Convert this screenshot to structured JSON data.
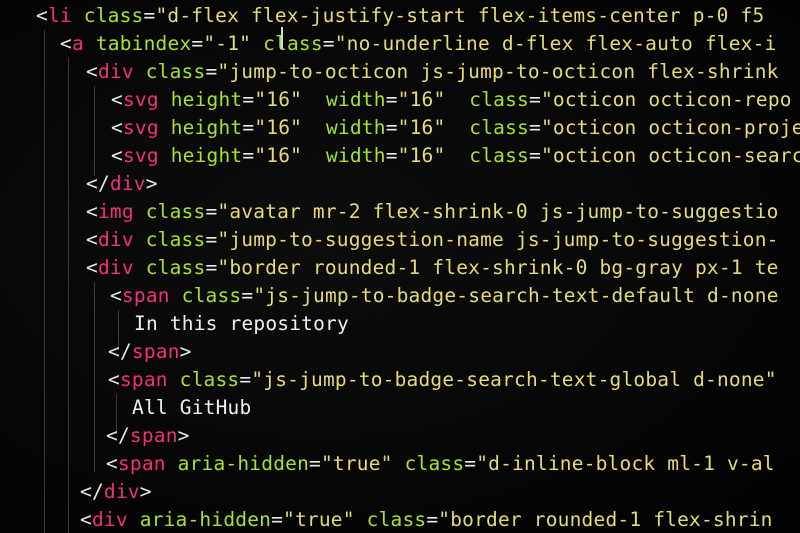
{
  "editor": {
    "lines": [
      {
        "indent": 36,
        "tokens": [
          [
            "punct",
            "<"
          ],
          [
            "tag",
            "li"
          ],
          [
            "text",
            " "
          ],
          [
            "attr",
            "class"
          ],
          [
            "eq",
            "="
          ],
          [
            "str",
            "\"d-flex flex-justify-start flex-items-center p-0 f5"
          ]
        ]
      },
      {
        "indent": 60,
        "tokens": [
          [
            "punct",
            "<"
          ],
          [
            "tag",
            "a"
          ],
          [
            "text",
            " "
          ],
          [
            "attr",
            "tabindex"
          ],
          [
            "eq",
            "="
          ],
          [
            "str",
            "\"-1\""
          ],
          [
            "text",
            " "
          ],
          [
            "attr",
            "class"
          ],
          [
            "eq",
            "="
          ],
          [
            "str",
            "\"no-underline d-flex flex-auto flex-i"
          ]
        ]
      },
      {
        "indent": 86,
        "tokens": [
          [
            "punct",
            "<"
          ],
          [
            "tag",
            "div"
          ],
          [
            "text",
            " "
          ],
          [
            "attr",
            "class"
          ],
          [
            "eq",
            "="
          ],
          [
            "str",
            "\"jump-to-octicon js-jump-to-octicon flex-shrink"
          ]
        ]
      },
      {
        "indent": 111,
        "tokens": [
          [
            "punct",
            "<"
          ],
          [
            "tag",
            "svg"
          ],
          [
            "text",
            " "
          ],
          [
            "attr",
            "height"
          ],
          [
            "eq",
            "="
          ],
          [
            "str",
            "\"16\""
          ],
          [
            "text",
            "  "
          ],
          [
            "attr",
            "width"
          ],
          [
            "eq",
            "="
          ],
          [
            "str",
            "\"16\""
          ],
          [
            "text",
            "  "
          ],
          [
            "attr",
            "class"
          ],
          [
            "eq",
            "="
          ],
          [
            "str",
            "\"octicon octicon-repo"
          ]
        ]
      },
      {
        "indent": 111,
        "tokens": [
          [
            "punct",
            "<"
          ],
          [
            "tag",
            "svg"
          ],
          [
            "text",
            " "
          ],
          [
            "attr",
            "height"
          ],
          [
            "eq",
            "="
          ],
          [
            "str",
            "\"16\""
          ],
          [
            "text",
            "  "
          ],
          [
            "attr",
            "width"
          ],
          [
            "eq",
            "="
          ],
          [
            "str",
            "\"16\""
          ],
          [
            "text",
            "  "
          ],
          [
            "attr",
            "class"
          ],
          [
            "eq",
            "="
          ],
          [
            "str",
            "\"octicon octicon-proje"
          ]
        ]
      },
      {
        "indent": 111,
        "tokens": [
          [
            "punct",
            "<"
          ],
          [
            "tag",
            "svg"
          ],
          [
            "text",
            " "
          ],
          [
            "attr",
            "height"
          ],
          [
            "eq",
            "="
          ],
          [
            "str",
            "\"16\""
          ],
          [
            "text",
            "  "
          ],
          [
            "attr",
            "width"
          ],
          [
            "eq",
            "="
          ],
          [
            "str",
            "\"16\""
          ],
          [
            "text",
            "  "
          ],
          [
            "attr",
            "class"
          ],
          [
            "eq",
            "="
          ],
          [
            "str",
            "\"octicon octicon-searc"
          ]
        ]
      },
      {
        "indent": 86,
        "tokens": [
          [
            "punct",
            "</"
          ],
          [
            "tag",
            "div"
          ],
          [
            "punct",
            ">"
          ]
        ]
      },
      {
        "indent": 86,
        "tokens": [
          [
            "punct",
            "<"
          ],
          [
            "tag",
            "img"
          ],
          [
            "text",
            " "
          ],
          [
            "attr",
            "class"
          ],
          [
            "eq",
            "="
          ],
          [
            "str",
            "\"avatar mr-2 flex-shrink-0 js-jump-to-suggestio"
          ]
        ]
      },
      {
        "indent": 86,
        "tokens": [
          [
            "punct",
            "<"
          ],
          [
            "tag",
            "div"
          ],
          [
            "text",
            " "
          ],
          [
            "attr",
            "class"
          ],
          [
            "eq",
            "="
          ],
          [
            "str",
            "\"jump-to-suggestion-name js-jump-to-suggestion-"
          ]
        ]
      },
      {
        "indent": 86,
        "tokens": [
          [
            "punct",
            "<"
          ],
          [
            "tag",
            "div"
          ],
          [
            "text",
            " "
          ],
          [
            "attr",
            "class"
          ],
          [
            "eq",
            "="
          ],
          [
            "str",
            "\"border rounded-1 flex-shrink-0 bg-gray px-1 te"
          ]
        ]
      },
      {
        "indent": 110,
        "tokens": [
          [
            "punct",
            "<"
          ],
          [
            "tag",
            "span"
          ],
          [
            "text",
            " "
          ],
          [
            "attr",
            "class"
          ],
          [
            "eq",
            "="
          ],
          [
            "str",
            "\"js-jump-to-badge-search-text-default d-none"
          ]
        ]
      },
      {
        "indent": 134,
        "tokens": [
          [
            "text",
            "In this repository"
          ]
        ]
      },
      {
        "indent": 108,
        "tokens": [
          [
            "punct",
            "</"
          ],
          [
            "tag",
            "span"
          ],
          [
            "punct",
            ">"
          ]
        ]
      },
      {
        "indent": 108,
        "tokens": [
          [
            "punct",
            "<"
          ],
          [
            "tag",
            "span"
          ],
          [
            "text",
            " "
          ],
          [
            "attr",
            "class"
          ],
          [
            "eq",
            "="
          ],
          [
            "str",
            "\"js-jump-to-badge-search-text-global d-none\""
          ]
        ]
      },
      {
        "indent": 132,
        "tokens": [
          [
            "text",
            "All GitHub"
          ]
        ]
      },
      {
        "indent": 106,
        "tokens": [
          [
            "punct",
            "</"
          ],
          [
            "tag",
            "span"
          ],
          [
            "punct",
            ">"
          ]
        ]
      },
      {
        "indent": 106,
        "tokens": [
          [
            "punct",
            "<"
          ],
          [
            "tag",
            "span"
          ],
          [
            "text",
            " "
          ],
          [
            "attr",
            "aria-hidden"
          ],
          [
            "eq",
            "="
          ],
          [
            "str",
            "\"true\""
          ],
          [
            "text",
            " "
          ],
          [
            "attr",
            "class"
          ],
          [
            "eq",
            "="
          ],
          [
            "str",
            "\"d-inline-block ml-1 v-al"
          ]
        ]
      },
      {
        "indent": 80,
        "tokens": [
          [
            "punct",
            "</"
          ],
          [
            "tag",
            "div"
          ],
          [
            "punct",
            ">"
          ]
        ]
      },
      {
        "indent": 80,
        "tokens": [
          [
            "punct",
            "<"
          ],
          [
            "tag",
            "div"
          ],
          [
            "text",
            " "
          ],
          [
            "attr",
            "aria-hidden"
          ],
          [
            "eq",
            "="
          ],
          [
            "str",
            "\"true\""
          ],
          [
            "text",
            " "
          ],
          [
            "attr",
            "class"
          ],
          [
            "eq",
            "="
          ],
          [
            "str",
            "\"border rounded-1 flex-shrin"
          ]
        ]
      }
    ]
  },
  "colors": {
    "background": "#050505",
    "tag": "#f0307a",
    "attribute": "#a6e22e",
    "string": "#e6db74",
    "text": "#f0f0f0"
  }
}
